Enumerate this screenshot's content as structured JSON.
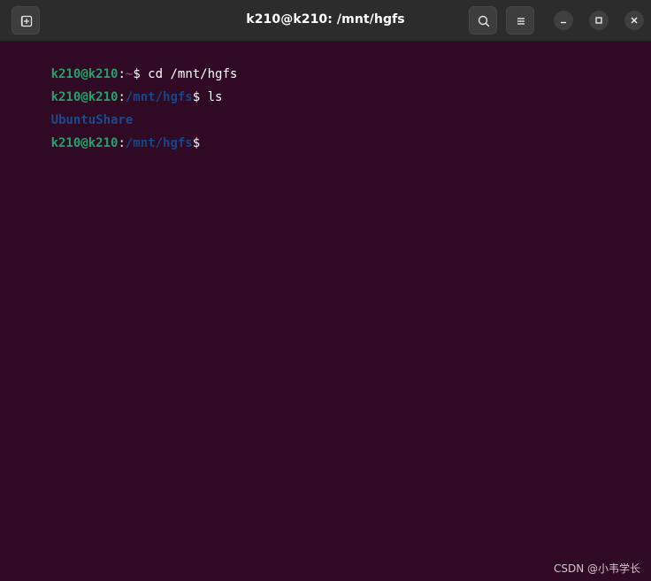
{
  "window": {
    "title": "k210@k210: /mnt/hgfs"
  },
  "icons": {
    "new_tab": "new-tab-icon",
    "search": "search-icon",
    "menu": "hamburger-menu-icon",
    "minimize": "minimize-icon",
    "maximize": "maximize-icon",
    "close": "close-icon"
  },
  "terminal": {
    "lines": [
      {
        "user": "k210@k210",
        "colon": ":",
        "path": "~",
        "sigil": "$",
        "command": " cd /mnt/hgfs"
      },
      {
        "user": "k210@k210",
        "colon": ":",
        "path": "/mnt/hgfs",
        "sigil": "$",
        "command": " ls"
      },
      {
        "output": "UbuntuShare"
      },
      {
        "user": "k210@k210",
        "colon": ":",
        "path": "/mnt/hgfs",
        "sigil": "$",
        "command": ""
      }
    ]
  },
  "colors": {
    "background": "#300a24",
    "titlebar": "#2c2c2c",
    "prompt_user": "#26a269",
    "prompt_path": "#12488b",
    "directory": "#1c4a8c"
  },
  "watermark": "CSDN @小韦学长"
}
